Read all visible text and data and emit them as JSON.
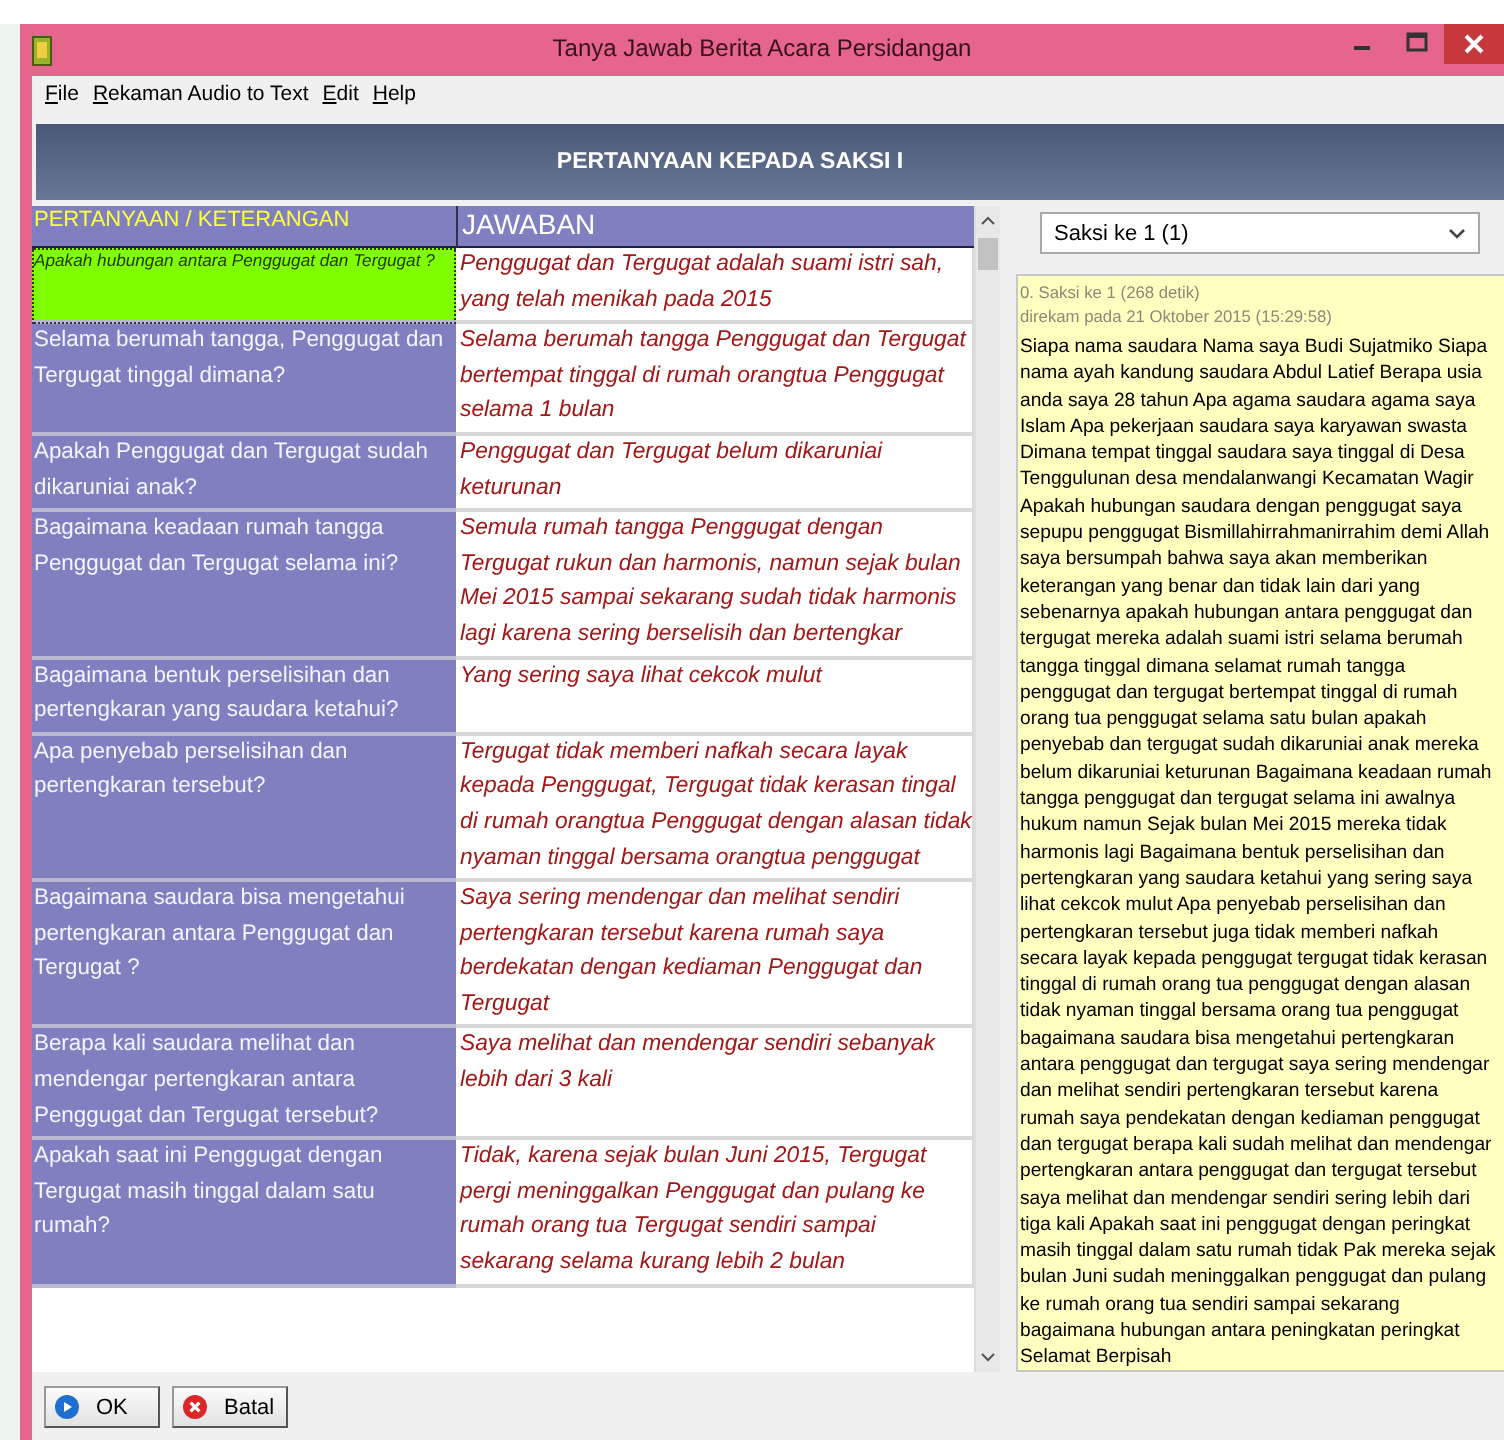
{
  "window": {
    "title": "Tanya Jawab Berita Acara Persidangan"
  },
  "menu": [
    {
      "label": "File"
    },
    {
      "label": "Rekaman Audio to Text"
    },
    {
      "label": "Edit"
    },
    {
      "label": "Help"
    }
  ],
  "banner": "PERTANYAAN KEPADA SAKSI I",
  "table": {
    "columns": [
      "PERTANYAAN / KETERANGAN",
      "JAWABAN"
    ],
    "rows": [
      {
        "question": "Apakah hubungan antara Penggugat dan Tergugat ?",
        "answer": "Penggugat dan Tergugat adalah suami istri sah, yang telah menikah pada 2015",
        "selected": true
      },
      {
        "question": "Selama berumah tangga, Penggugat dan Tergugat tinggal dimana?",
        "answer": "Selama berumah tangga Penggugat dan Tergugat bertempat tinggal di rumah orangtua Penggugat selama 1 bulan",
        "selected": false
      },
      {
        "question": "Apakah Penggugat dan Tergugat sudah dikaruniai anak?",
        "answer": "Penggugat dan Tergugat belum dikaruniai keturunan",
        "selected": false
      },
      {
        "question": "Bagaimana keadaan rumah tangga Penggugat  dan Tergugat selama ini?",
        "answer": "Semula rumah tangga Penggugat dengan Tergugat rukun dan harmonis, namun sejak bulan Mei 2015 sampai sekarang sudah tidak harmonis lagi karena sering berselisih dan bertengkar",
        "selected": false
      },
      {
        "question": "Bagaimana bentuk perselisihan dan pertengkaran yang saudara ketahui?",
        "answer": "Yang sering saya lihat cekcok mulut",
        "selected": false
      },
      {
        "question": "Apa penyebab perselisihan dan pertengkaran tersebut?",
        "answer": "Tergugat tidak memberi nafkah secara layak kepada Penggugat, Tergugat tidak kerasan tingal di rumah orangtua Penggugat dengan alasan tidak nyaman tinggal bersama orangtua penggugat",
        "selected": false
      },
      {
        "question": "Bagaimana saudara bisa mengetahui pertengkaran antara Penggugat dan Tergugat ?",
        "answer": "Saya sering mendengar dan melihat sendiri pertengkaran tersebut karena rumah saya berdekatan dengan kediaman Penggugat dan Tergugat",
        "selected": false
      },
      {
        "question": "Berapa kali saudara melihat dan mendengar pertengkaran antara Penggugat dan Tergugat  tersebut?",
        "answer": "Saya melihat dan mendengar sendiri sebanyak lebih dari 3 kali",
        "selected": false
      },
      {
        "question": "Apakah saat ini Penggugat dengan Tergugat masih tinggal dalam satu rumah?",
        "answer": "Tidak, karena sejak bulan Juni 2015, Tergugat pergi meninggalkan Penggugat dan pulang ke rumah orang tua Tergugat sendiri sampai sekarang selama kurang lebih 2 bulan",
        "selected": false
      }
    ]
  },
  "witness_select": {
    "value": "Saksi ke 1 (1)"
  },
  "transcript": {
    "heading": "0. Saksi ke 1 (268 detik)",
    "recorded": "direkam pada 21 Oktober 2015 (15:29:58)",
    "text": "Siapa nama saudara Nama saya Budi Sujatmiko Siapa nama ayah kandung saudara Abdul Latief Berapa usia anda saya 28 tahun Apa agama saudara agama saya Islam Apa pekerjaan saudara saya karyawan swasta Dimana tempat tinggal saudara saya tinggal di Desa Tenggulunan desa mendalanwangi Kecamatan Wagir Apakah hubungan saudara dengan penggugat saya sepupu penggugat Bismillahirrahmanirrahim demi Allah saya bersumpah bahwa saya akan memberikan keterangan yang benar dan tidak lain dari yang sebenarnya apakah hubungan antara penggugat dan tergugat mereka adalah suami istri selama berumah tangga tinggal dimana selamat rumah tangga penggugat dan tergugat bertempat tinggal di rumah orang tua penggugat selama satu bulan apakah penyebab dan tergugat sudah dikaruniai anak mereka belum dikaruniai keturunan Bagaimana keadaan rumah tangga penggugat dan tergugat selama ini awalnya hukum namun Sejak bulan Mei 2015 mereka tidak harmonis lagi Bagaimana bentuk perselisihan dan pertengkaran yang saudara ketahui yang sering saya lihat cekcok mulut Apa penyebab perselisihan dan pertengkaran tersebut juga tidak memberi nafkah secara layak kepada penggugat tergugat tidak kerasan tinggal di rumah orang tua penggugat dengan alasan tidak nyaman tinggal bersama orang tua penggugat bagaimana saudara bisa mengetahui pertengkaran antara penggugat dan tergugat saya sering mendengar dan melihat sendiri pertengkaran tersebut karena rumah saya pendekatan dengan kediaman penggugat dan tergugat berapa kali sudah melihat dan mendengar pertengkaran antara penggugat dan tergugat tersebut saya melihat dan mendengar sendiri sering lebih dari tiga kali Apakah saat ini penggugat dengan peringkat masih tinggal dalam satu rumah tidak Pak mereka sejak bulan Juni sudah meninggalkan penggugat dan pulang ke rumah orang tua sendiri sampai sekarang bagaimana hubungan antara peningkatan peringkat Selamat Berpisah"
  },
  "buttons": [
    {
      "label": "OK",
      "kind": "ok"
    },
    {
      "label": "Batal",
      "kind": "cancel"
    }
  ]
}
